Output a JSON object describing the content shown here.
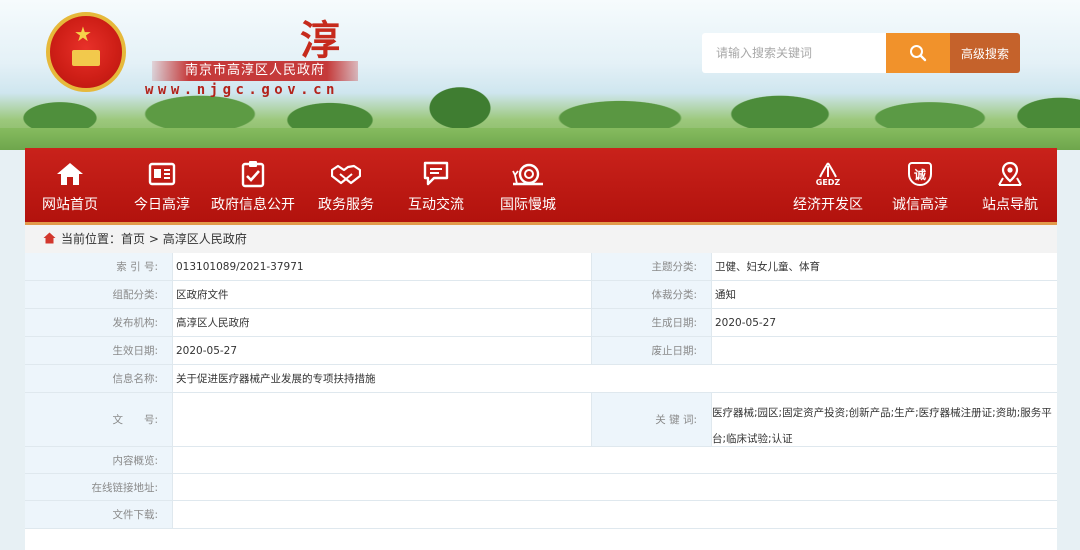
{
  "header": {
    "site_char": "淳",
    "site_name": "南京市高淳区人民政府",
    "domain": "www.njgc.gov.cn",
    "search_placeholder": "请输入搜索关键词",
    "advanced_search": "高级搜索"
  },
  "nav": {
    "left": [
      {
        "label": "网站首页",
        "icon": "home-icon"
      },
      {
        "label": "今日高淳",
        "icon": "newspaper-icon"
      },
      {
        "label": "政府信息公开",
        "icon": "clipboard-check-icon"
      },
      {
        "label": "政务服务",
        "icon": "handshake-icon"
      },
      {
        "label": "互动交流",
        "icon": "chat-icon"
      },
      {
        "label": "国际慢城",
        "icon": "snail-icon"
      }
    ],
    "right": [
      {
        "label": "经济开发区",
        "icon": "gedz-logo-icon",
        "icon_text": "GEDZ"
      },
      {
        "label": "诚信高淳",
        "icon": "integrity-badge-icon",
        "icon_text": "诚"
      },
      {
        "label": "站点导航",
        "icon": "location-pin-icon"
      }
    ],
    "colors": {
      "background": "#c01a14",
      "border": "#e29a4a"
    }
  },
  "breadcrumb": {
    "prefix": "当前位置：",
    "path": "首页 > 高淳区人民政府"
  },
  "info": {
    "index_label": "索 引 号:",
    "index_value": "013101089/2021-37971",
    "topic_label": "主题分类:",
    "topic_value": "卫健、妇女儿童、体育",
    "category_label": "组配分类:",
    "category_value": "区政府文件",
    "genre_label": "体裁分类:",
    "genre_value": "通知",
    "publisher_label": "发布机构:",
    "publisher_value": "高淳区人民政府",
    "created_label": "生成日期:",
    "created_value": "2020-05-27",
    "effective_label": "生效日期:",
    "effective_value": "2020-05-27",
    "repeal_label": "废止日期:",
    "repeal_value": "",
    "title_label": "信息名称:",
    "title_value": "关于促进医疗器械产业发展的专项扶持措施",
    "docno_label": "文　　号:",
    "docno_value": "",
    "keywords_label": "关 键 词:",
    "keywords_value": "医疗器械;园区;固定资产投资;创新产品;生产;医疗器械注册证;资助;服务平台;临床试验;认证",
    "summary_label": "内容概览:",
    "summary_value": "",
    "link_label": "在线链接地址:",
    "link_value": "",
    "download_label": "文件下载:",
    "download_value": ""
  }
}
